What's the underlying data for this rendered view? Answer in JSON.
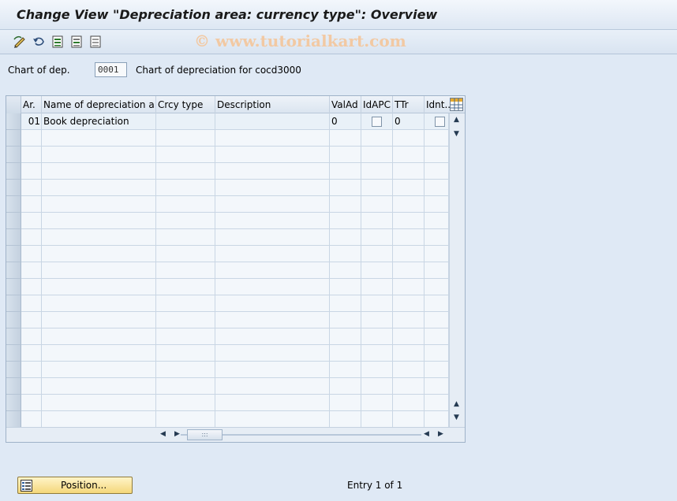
{
  "window": {
    "title": "Change View \"Depreciation area: currency type\": Overview"
  },
  "toolbar": {
    "watermark": "© www.tutorialkart.com",
    "icons": [
      "display-change-icon",
      "undo-icon",
      "select-all-icon",
      "select-block-icon",
      "deselect-all-icon"
    ]
  },
  "chart_of_dep": {
    "label": "Chart of dep.",
    "value": "0001",
    "description": "Chart of depreciation for cocd3000"
  },
  "table": {
    "columns": [
      {
        "key": "ar",
        "label": "Ar."
      },
      {
        "key": "name",
        "label": "Name of depreciation a..."
      },
      {
        "key": "crcy",
        "label": "Crcy type"
      },
      {
        "key": "desc",
        "label": "Description"
      },
      {
        "key": "valad",
        "label": "ValAd"
      },
      {
        "key": "idapc",
        "label": "IdAPC"
      },
      {
        "key": "ttr",
        "label": "TTr"
      },
      {
        "key": "idnt",
        "label": "Idnt.."
      }
    ],
    "rows": [
      {
        "ar": "01",
        "name": "Book depreciation",
        "crcy": "",
        "desc": "",
        "valad": "0",
        "idapc": false,
        "ttr": "0",
        "idnt": false
      }
    ]
  },
  "footer": {
    "position_button": "Position...",
    "entry_status": "Entry 1 of 1"
  },
  "colors": {
    "background": "#dfe9f5",
    "button": "#f4d77a"
  }
}
